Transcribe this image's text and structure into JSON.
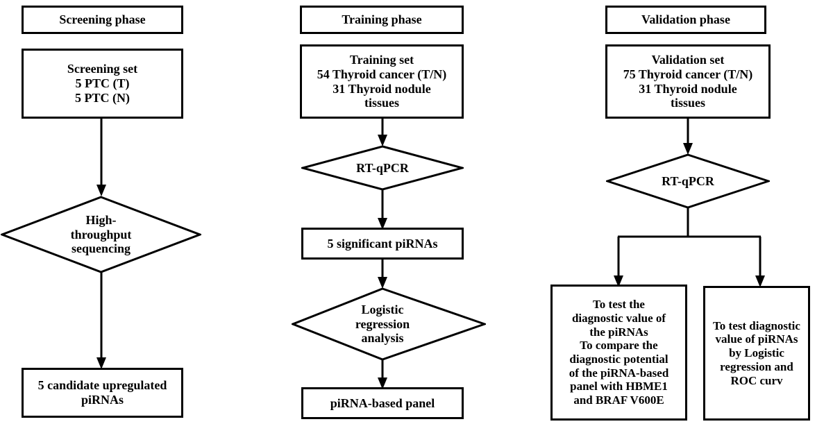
{
  "figure": {
    "type": "flowchart",
    "description": "Three-phase study workflow flowchart",
    "line_color": "#000000",
    "fill_color": "#ffffff",
    "text_color": "#000000"
  },
  "columns": [
    {
      "id": "screening",
      "header": "Screening phase",
      "nodes": [
        {
          "id": "screening-set",
          "shape": "box",
          "text": "Screening set\n5 PTC (T)\n5 PTC (N)"
        },
        {
          "id": "high-throughput-sequencing",
          "shape": "diamond",
          "text": "High-\nthroughput\nsequencing"
        },
        {
          "id": "candidate-pirnas",
          "shape": "box",
          "text": "5 candidate upregulated\npiRNAs"
        }
      ]
    },
    {
      "id": "training",
      "header": "Training phase",
      "nodes": [
        {
          "id": "training-set",
          "shape": "box",
          "text": "Training set\n54 Thyroid cancer (T/N)\n31 Thyroid nodule\ntissues"
        },
        {
          "id": "training-rt-qpcr",
          "shape": "diamond",
          "text": "RT-qPCR"
        },
        {
          "id": "significant-pirnas",
          "shape": "box",
          "text": "5 significant piRNAs"
        },
        {
          "id": "logistic-regression-analysis",
          "shape": "diamond",
          "text": "Logistic\nregression\nanalysis"
        },
        {
          "id": "pirna-based-panel",
          "shape": "box",
          "text": "piRNA-based panel"
        }
      ]
    },
    {
      "id": "validation",
      "header": "Validation phase",
      "nodes": [
        {
          "id": "validation-set",
          "shape": "box",
          "text": "Validation set\n75 Thyroid cancer (T/N)\n31 Thyroid nodule\ntissues"
        },
        {
          "id": "validation-rt-qpcr",
          "shape": "diamond",
          "text": "RT-qPCR"
        },
        {
          "id": "validation-outcome-left",
          "shape": "box",
          "text": "To test the\ndiagnostic value of\nthe piRNAs\nTo compare the\ndiagnostic potential\nof the piRNA-based\npanel with HBME1\nand BRAF V600E"
        },
        {
          "id": "validation-outcome-right",
          "shape": "box",
          "text": "To test diagnostic\nvalue of piRNAs\nby Logistic\nregression and\nROC curv"
        }
      ]
    }
  ]
}
